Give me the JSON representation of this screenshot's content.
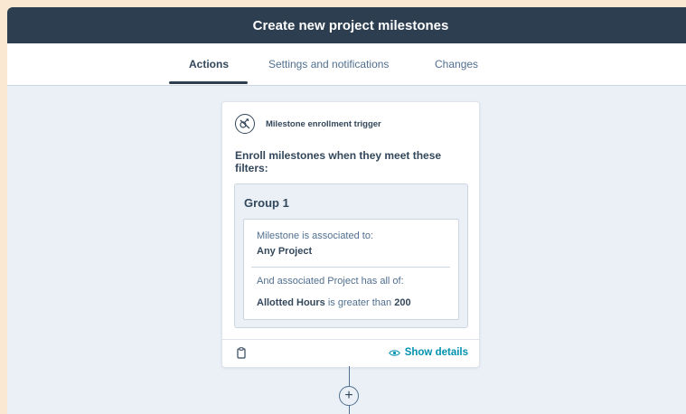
{
  "window": {
    "title": "Create new project milestones"
  },
  "tabs": [
    {
      "label": "Actions",
      "active": true
    },
    {
      "label": "Settings and notifications",
      "active": false
    },
    {
      "label": "Changes",
      "active": false
    }
  ],
  "trigger_card": {
    "icon": "unlink-icon",
    "header": "Milestone enrollment trigger",
    "description": "Enroll milestones when they meet these filters:",
    "group": {
      "title": "Group 1",
      "filter_1_label": "Milestone is associated to:",
      "filter_1_value": "Any Project",
      "filter_2_label": "And associated Project has all of:",
      "filter_2_property": "Allotted Hours",
      "filter_2_operator": " is greater than ",
      "filter_2_value": "200"
    },
    "footer": {
      "delete_icon": "clipboard-icon",
      "show_details_label": "Show details",
      "show_details_icon": "eye-icon"
    }
  },
  "add_action": {
    "icon": "plus-icon"
  },
  "colors": {
    "header_bg": "#2d3e50",
    "canvas_bg": "#eaf0f6",
    "link": "#0091ae",
    "page_bg": "#fbe8d2"
  }
}
